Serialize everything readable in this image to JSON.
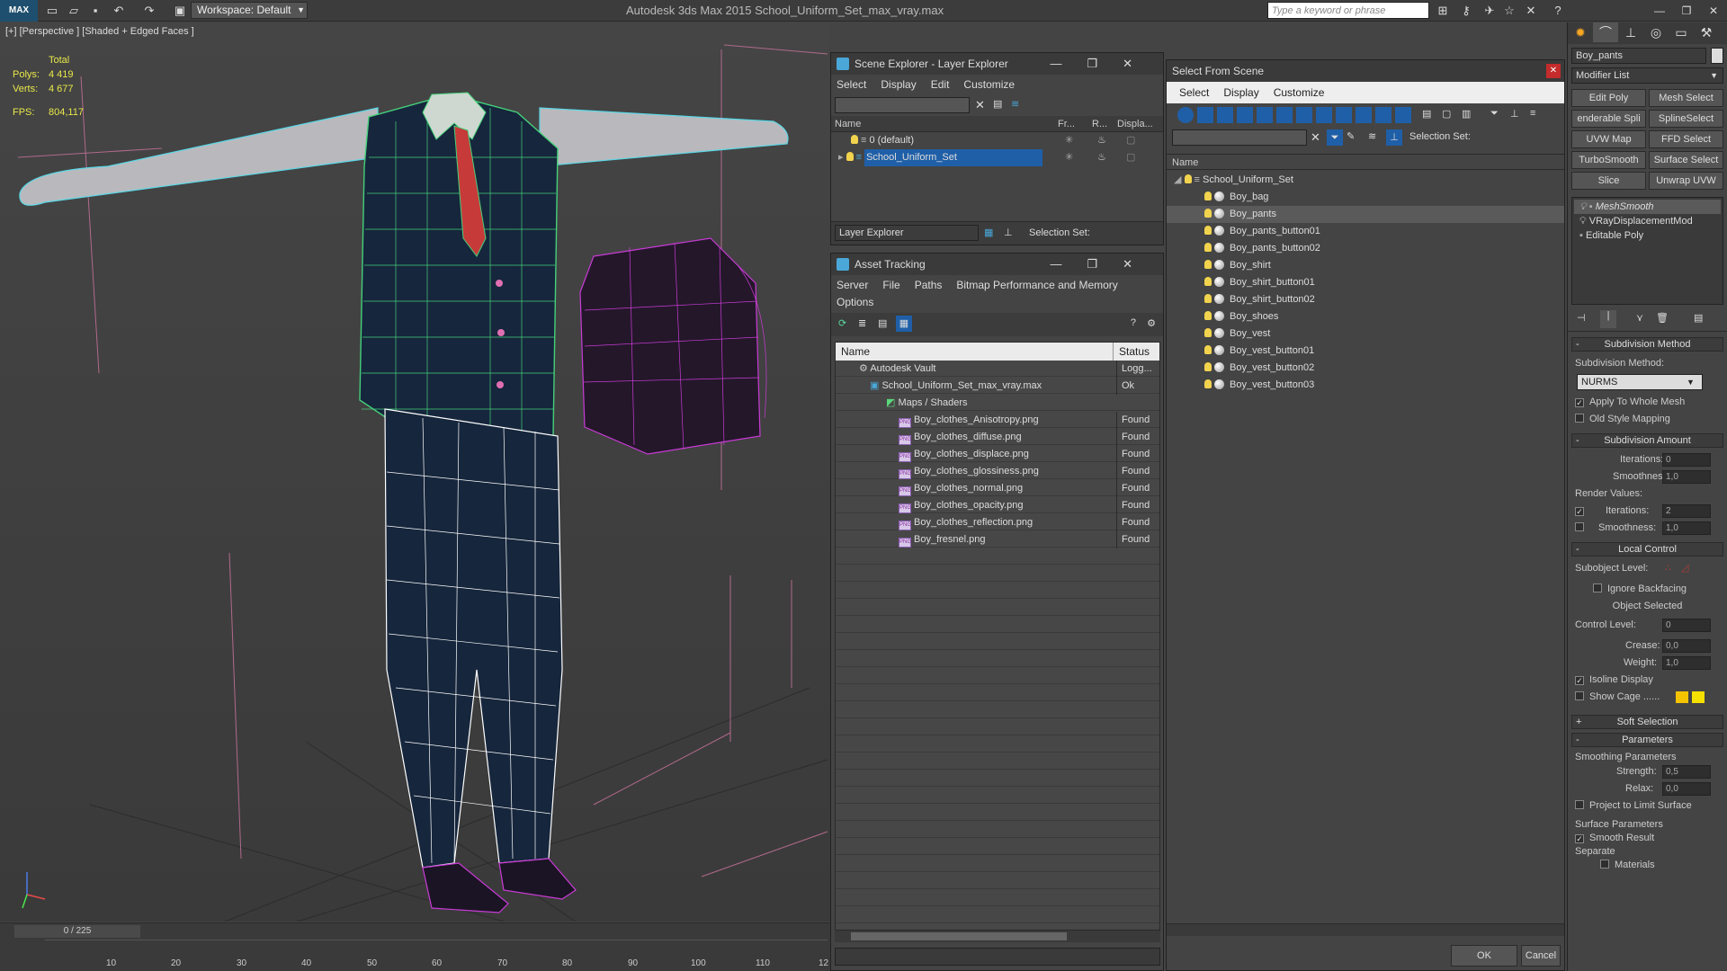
{
  "app": {
    "title": "Autodesk 3ds Max  2015     School_Uniform_Set_max_vray.max",
    "workspace": "Workspace: Default",
    "search_placeholder": "Type a keyword or phrase",
    "logo": "MAX"
  },
  "viewport": {
    "label": "[+] [Perspective ] [Shaded + Edged Faces ]",
    "stats": {
      "total": "Total",
      "polys_label": "Polys:",
      "polys": "4 419",
      "verts_label": "Verts:",
      "verts": "4 677",
      "fps_label": "FPS:",
      "fps": "804,117"
    }
  },
  "timeline": {
    "frame": "0 / 225",
    "ticks": [
      "10",
      "20",
      "30",
      "40",
      "50",
      "60",
      "70",
      "80",
      "90",
      "100",
      "110",
      "12"
    ]
  },
  "scene_explorer": {
    "title": "Scene Explorer - Layer Explorer",
    "menus": [
      "Select",
      "Display",
      "Edit",
      "Customize"
    ],
    "columns": [
      "Name",
      "Fr...",
      "R...",
      "Displa..."
    ],
    "rows": [
      {
        "name": "0 (default)",
        "selected": false
      },
      {
        "name": "School_Uniform_Set",
        "selected": true
      }
    ],
    "footer_label": "Layer Explorer",
    "selection_set": "Selection Set:"
  },
  "asset_tracking": {
    "title": "Asset Tracking",
    "menus": [
      "Server",
      "File",
      "Paths",
      "Bitmap Performance and Memory",
      "Options"
    ],
    "columns": [
      "Name",
      "Status"
    ],
    "rows": [
      {
        "name": "Autodesk Vault",
        "status": "Logg...",
        "indent": 1,
        "icon": "vault"
      },
      {
        "name": "School_Uniform_Set_max_vray.max",
        "status": "Ok",
        "indent": 2,
        "icon": "max"
      },
      {
        "name": "Maps / Shaders",
        "status": "",
        "indent": 3,
        "icon": "maps"
      },
      {
        "name": "Boy_clothes_Anisotropy.png",
        "status": "Found",
        "indent": 4,
        "icon": "png"
      },
      {
        "name": "Boy_clothes_diffuse.png",
        "status": "Found",
        "indent": 4,
        "icon": "png"
      },
      {
        "name": "Boy_clothes_displace.png",
        "status": "Found",
        "indent": 4,
        "icon": "png"
      },
      {
        "name": "Boy_clothes_glossiness.png",
        "status": "Found",
        "indent": 4,
        "icon": "png"
      },
      {
        "name": "Boy_clothes_normal.png",
        "status": "Found",
        "indent": 4,
        "icon": "png"
      },
      {
        "name": "Boy_clothes_opacity.png",
        "status": "Found",
        "indent": 4,
        "icon": "png"
      },
      {
        "name": "Boy_clothes_reflection.png",
        "status": "Found",
        "indent": 4,
        "icon": "png"
      },
      {
        "name": "Boy_fresnel.png",
        "status": "Found",
        "indent": 4,
        "icon": "png"
      }
    ],
    "png_tag": "PNG"
  },
  "select_from_scene": {
    "title": "Select From Scene",
    "menus": [
      "Select",
      "Display",
      "Customize"
    ],
    "selection_set": "Selection Set:",
    "column": "Name",
    "root": "School_Uniform_Set",
    "items": [
      {
        "name": "Boy_bag",
        "selected": false
      },
      {
        "name": "Boy_pants",
        "selected": true
      },
      {
        "name": "Boy_pants_button01",
        "selected": false
      },
      {
        "name": "Boy_pants_button02",
        "selected": false
      },
      {
        "name": "Boy_shirt",
        "selected": false
      },
      {
        "name": "Boy_shirt_button01",
        "selected": false
      },
      {
        "name": "Boy_shirt_button02",
        "selected": false
      },
      {
        "name": "Boy_shoes",
        "selected": false
      },
      {
        "name": "Boy_vest",
        "selected": false
      },
      {
        "name": "Boy_vest_button01",
        "selected": false
      },
      {
        "name": "Boy_vest_button02",
        "selected": false
      },
      {
        "name": "Boy_vest_button03",
        "selected": false
      }
    ],
    "ok": "OK",
    "cancel": "Cancel"
  },
  "command_panel": {
    "object_name": "Boy_pants",
    "modifier_list": "Modifier List",
    "buttons": [
      "Edit Poly",
      "Mesh Select",
      "enderable Spli",
      "SplineSelect",
      "UVW Map",
      "FFD Select",
      "TurboSmooth",
      "Surface Select",
      "Slice",
      "Unwrap UVW"
    ],
    "stack": [
      "MeshSmooth",
      "VRayDisplacementMod",
      "Editable Poly"
    ],
    "subdivision_method": {
      "title": "Subdivision Method",
      "label": "Subdivision Method:",
      "value": "NURMS",
      "apply_whole": "Apply To Whole Mesh",
      "old_style": "Old Style Mapping"
    },
    "subdivision_amount": {
      "title": "Subdivision Amount",
      "iterations": "Iterations:",
      "iterations_val": "0",
      "smoothness": "Smoothness:",
      "smoothness_val": "1,0",
      "render_values": "Render Values:",
      "r_iterations_val": "2",
      "r_smoothness_val": "1,0"
    },
    "local_control": {
      "title": "Local Control",
      "subobject": "Subobject Level:",
      "ignore_backfacing": "Ignore Backfacing",
      "object_selected": "Object Selected",
      "control_level": "Control Level:",
      "control_level_val": "0",
      "crease": "Crease:",
      "crease_val": "0,0",
      "weight": "Weight:",
      "weight_val": "1,0",
      "isoline": "Isoline Display",
      "show_cage": "Show Cage ......"
    },
    "soft_selection": "Soft Selection",
    "parameters": {
      "title": "Parameters",
      "smoothing": "Smoothing Parameters",
      "strength": "Strength:",
      "strength_val": "0,5",
      "relax": "Relax:",
      "relax_val": "0,0",
      "project": "Project to Limit Surface",
      "surface": "Surface Parameters",
      "smooth_result": "Smooth Result",
      "separate": "Separate",
      "materials": "Materials"
    },
    "colors": {
      "cage1": "#f5c400",
      "cage2": "#f5e000"
    }
  }
}
